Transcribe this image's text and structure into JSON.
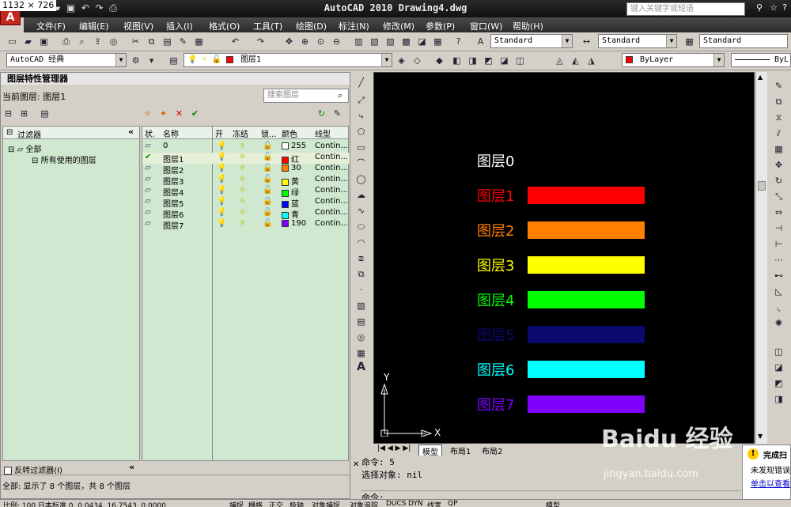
{
  "dim_label": "1132 × 726",
  "title": "AutoCAD 2010  Drawing4.dwg",
  "search_placeholder": "键入关键字或短语",
  "menu": [
    "文件(F)",
    "编辑(E)",
    "视图(V)",
    "插入(I)",
    "格式(O)",
    "工具(T)",
    "绘图(D)",
    "标注(N)",
    "修改(M)",
    "参数(P)",
    "窗口(W)",
    "帮助(H)"
  ],
  "toolbar": {
    "text_style": "Standard",
    "dim_style": "Standard",
    "table_style": "Standard",
    "workspace": "AutoCAD 经典",
    "current_layer": "图层1",
    "color": "ByLayer",
    "linetype": "ByL"
  },
  "palette": {
    "title": "图层特性管理器",
    "current_layer_label": "当前图层: 图层1",
    "search_placeholder": "搜索图层",
    "filters_header": "过滤器",
    "filter_all": "全部",
    "filter_used": "所有使用的图层",
    "invert_filter": "反转过滤器(I)",
    "footer": "全部: 显示了 8 个图层，共 8 个图层",
    "columns": {
      "status": "状.",
      "name": "名称",
      "on": "开",
      "freeze": "冻结",
      "lock": "锁...",
      "color": "颜色",
      "linetype": "线型"
    },
    "layers": [
      {
        "name": "0",
        "color_name": "255",
        "hex": "#ffffff",
        "linetype": "Contin...",
        "current": false,
        "locked": false
      },
      {
        "name": "图层1",
        "color_name": "红",
        "hex": "#ff0000",
        "linetype": "Contin...",
        "current": true,
        "locked": false
      },
      {
        "name": "图层2",
        "color_name": "30",
        "hex": "#ff7f00",
        "linetype": "Contin...",
        "current": false,
        "locked": false
      },
      {
        "name": "图层3",
        "color_name": "黄",
        "hex": "#ffff00",
        "linetype": "Contin...",
        "current": false,
        "locked": false
      },
      {
        "name": "图层4",
        "color_name": "绿",
        "hex": "#00ff00",
        "linetype": "Contin...",
        "current": false,
        "locked": false
      },
      {
        "name": "图层5",
        "color_name": "蓝",
        "hex": "#0000ff",
        "linetype": "Contin...",
        "current": false,
        "locked": true
      },
      {
        "name": "图层6",
        "color_name": "青",
        "hex": "#00ffff",
        "linetype": "Contin...",
        "current": false,
        "locked": false
      },
      {
        "name": "图层7",
        "color_name": "190",
        "hex": "#7f00ff",
        "linetype": "Contin...",
        "current": false,
        "locked": false
      }
    ]
  },
  "drawing": {
    "labels": [
      {
        "text": "图层0",
        "color": "#ffffff",
        "bar": null
      },
      {
        "text": "图层1",
        "color": "#ff0000",
        "bar": "#ff0000"
      },
      {
        "text": "图层2",
        "color": "#ff7f00",
        "bar": "#ff7f00"
      },
      {
        "text": "图层3",
        "color": "#ffff00",
        "bar": "#ffff00"
      },
      {
        "text": "图层4",
        "color": "#00ff00",
        "bar": "#00ff00"
      },
      {
        "text": "图层5",
        "color": "#0a0a70",
        "bar": "#0a0a70"
      },
      {
        "text": "图层6",
        "color": "#00ffff",
        "bar": "#00ffff"
      },
      {
        "text": "图层7",
        "color": "#7f00ff",
        "bar": "#7f00ff"
      }
    ],
    "axis_x": "X",
    "axis_y": "Y",
    "tabs": [
      "模型",
      "布局1",
      "布局2"
    ]
  },
  "command": {
    "line1": "命令: 5",
    "line2": "选择对象: nil",
    "prompt": "命令:"
  },
  "notify": {
    "title": "完成扫",
    "body": "未发现错误",
    "link": "单击以查看"
  },
  "status": {
    "coords": "比例: 100  日本标准 0.  0.0434, 16.7543, 0.0000",
    "buttons": [
      "捕捉",
      "栅格",
      "正交",
      "极轴",
      "对象捕捉",
      "对象追踪",
      "DUCS",
      "DYN",
      "线宽",
      "QP"
    ],
    "model": "模型"
  },
  "watermark": {
    "text": "Baidu 经验",
    "url": "jingyan.baidu.com"
  }
}
